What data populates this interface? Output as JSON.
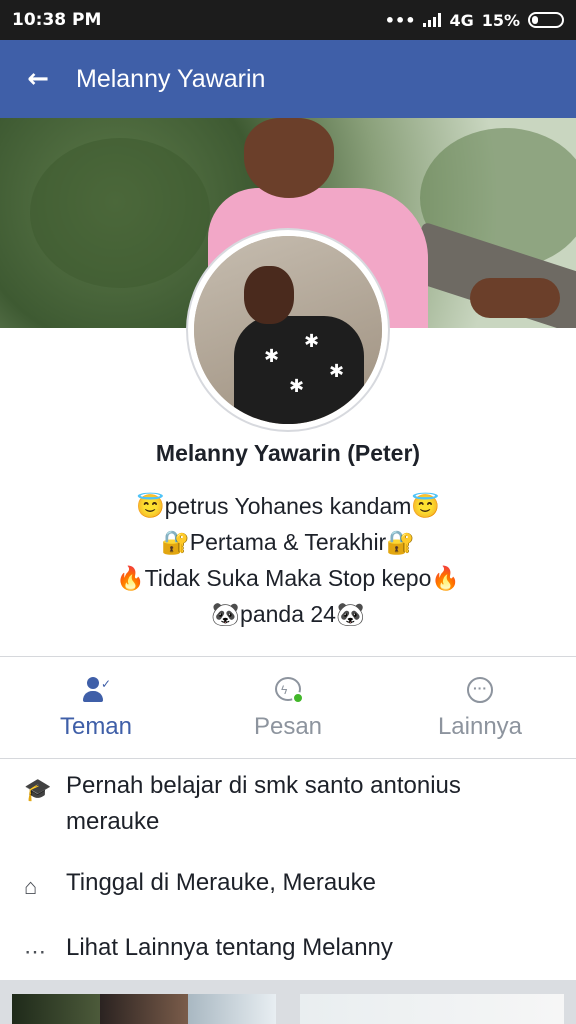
{
  "status_bar": {
    "time": "10:38 PM",
    "network": "4G",
    "battery": "15%"
  },
  "app_bar": {
    "back_icon": "arrow-left-icon",
    "title": "Melanny Yawarin"
  },
  "profile": {
    "name": "Melanny Yawarin (Peter)",
    "bio": [
      "😇petrus Yohanes kandam😇",
      "🔐Pertama & Terakhir🔐",
      "🔥Tidak Suka Maka Stop kepo🔥",
      "🐼panda 24🐼"
    ]
  },
  "actions": [
    {
      "label": "Teman",
      "icon": "friends-icon",
      "active": true
    },
    {
      "label": "Pesan",
      "icon": "messenger-icon",
      "active": false
    },
    {
      "label": "Lainnya",
      "icon": "more-icon",
      "active": false
    }
  ],
  "info": [
    {
      "icon": "education-icon",
      "text": "Pernah belajar di smk santo antonius merauke"
    },
    {
      "icon": "home-icon",
      "text": "Tinggal di Merauke, Merauke"
    },
    {
      "icon": "more-icon",
      "text": "Lihat Lainnya tentang Melanny"
    }
  ],
  "colors": {
    "brand": "#3f5fa8",
    "inactive": "#8d949e",
    "online": "#42b72a"
  }
}
